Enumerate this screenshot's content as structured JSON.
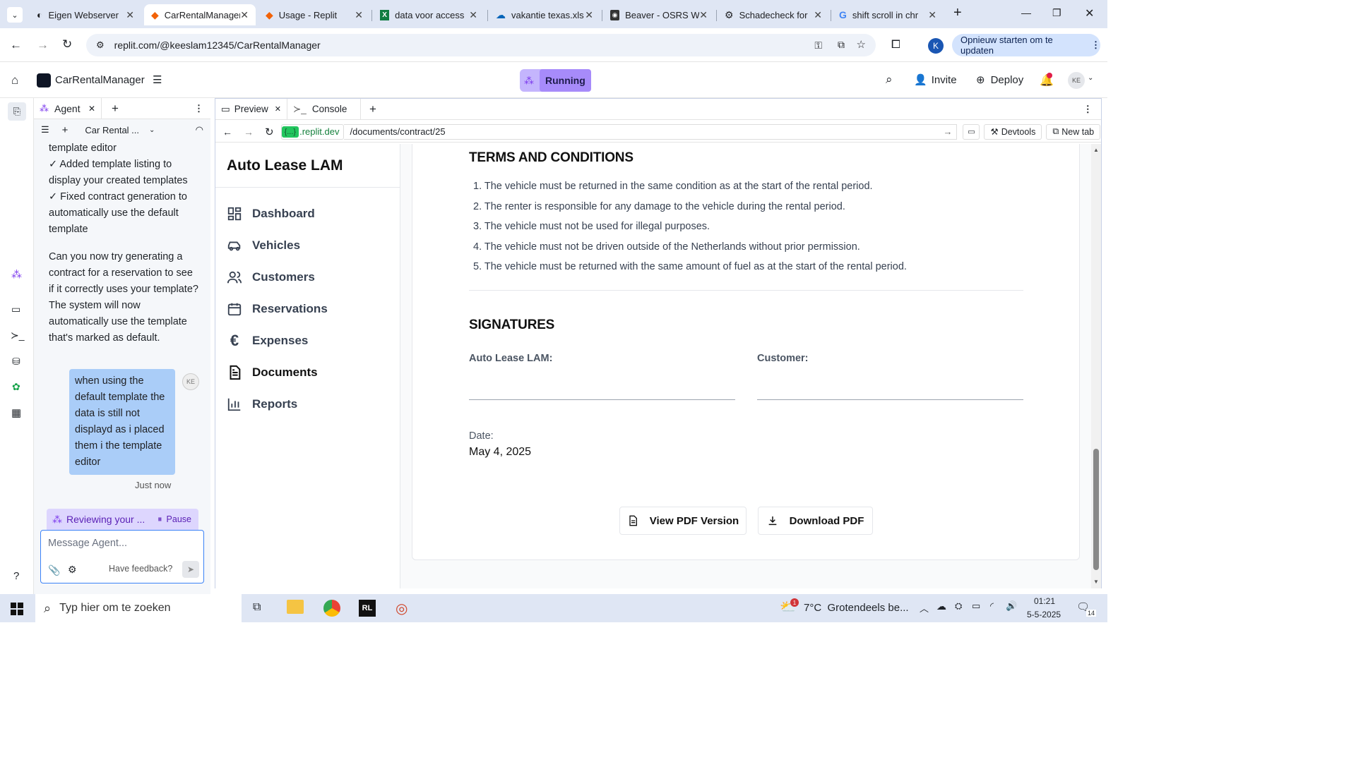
{
  "browser": {
    "tabs": [
      {
        "title": "Eigen Webserver",
        "icon": "globe-icon"
      },
      {
        "title": "CarRentalManager",
        "icon": "replit-icon"
      },
      {
        "title": "Usage - Replit",
        "icon": "replit-icon"
      },
      {
        "title": "data voor access",
        "icon": "excel-icon"
      },
      {
        "title": "vakantie texas.xls",
        "icon": "onedrive-icon"
      },
      {
        "title": "Beaver - OSRS W",
        "icon": "osrs-icon"
      },
      {
        "title": "Schadecheck for",
        "icon": "openai-icon"
      },
      {
        "title": "shift scroll in chr",
        "icon": "google-icon"
      }
    ],
    "url": "replit.com/@keeslam12345/CarRentalManager",
    "update_button": "Opnieuw starten om te updaten",
    "profile_initial": "K"
  },
  "replit": {
    "project_name": "CarRentalManager",
    "run_status": "Running",
    "invite_label": "Invite",
    "deploy_label": "Deploy",
    "avatar_initials": "KE"
  },
  "agent": {
    "tab_label": "Agent",
    "thread_name": "Car Rental ...",
    "messages": [
      "template editor",
      "✓ Added template listing to display your created templates",
      "✓ Fixed contract generation to automatically use the default template",
      "Can you now try generating a contract for a reservation to see if it correctly uses your template? The system will now automatically use the template that's marked as default."
    ],
    "user_message": "when using the default template the data is still not displayd as i placed them i the template editor",
    "user_initials": "KE",
    "timestamp": "Just now",
    "status": "Reviewing your ...",
    "pause_label": "Pause",
    "input_placeholder": "Message Agent...",
    "feedback_label": "Have feedback?"
  },
  "preview": {
    "tabs": [
      "Preview",
      "Console"
    ],
    "domain": ".replit.dev",
    "domain_prefix": "{...}",
    "path": "/documents/contract/25",
    "devtools_label": "Devtools",
    "new_tab_label": "New tab"
  },
  "app": {
    "brand": "Auto Lease LAM",
    "nav": [
      {
        "label": "Dashboard",
        "icon": "dashboard-icon"
      },
      {
        "label": "Vehicles",
        "icon": "car-icon"
      },
      {
        "label": "Customers",
        "icon": "users-icon"
      },
      {
        "label": "Reservations",
        "icon": "calendar-icon"
      },
      {
        "label": "Expenses",
        "icon": "euro-icon"
      },
      {
        "label": "Documents",
        "icon": "document-icon"
      },
      {
        "label": "Reports",
        "icon": "bar-chart-icon"
      }
    ],
    "terms_title": "TERMS AND CONDITIONS",
    "terms": [
      "1. The vehicle must be returned in the same condition as at the start of the rental period.",
      "2. The renter is responsible for any damage to the vehicle during the rental period.",
      "3. The vehicle must not be used for illegal purposes.",
      "4. The vehicle must not be driven outside of the Netherlands without prior permission.",
      "5. The vehicle must be returned with the same amount of fuel as at the start of the rental period."
    ],
    "signatures_title": "SIGNATURES",
    "sig_company": "Auto Lease LAM:",
    "sig_customer": "Customer:",
    "date_label": "Date:",
    "date_value": "May 4, 2025",
    "view_pdf": "View PDF Version",
    "download_pdf": "Download PDF"
  },
  "taskbar": {
    "search_placeholder": "Typ hier om te zoeken",
    "weather": "7°C  Grotendeels be...",
    "weather_badge": "1",
    "time": "01:21",
    "date": "5-5-2025",
    "notif_count": "14"
  }
}
